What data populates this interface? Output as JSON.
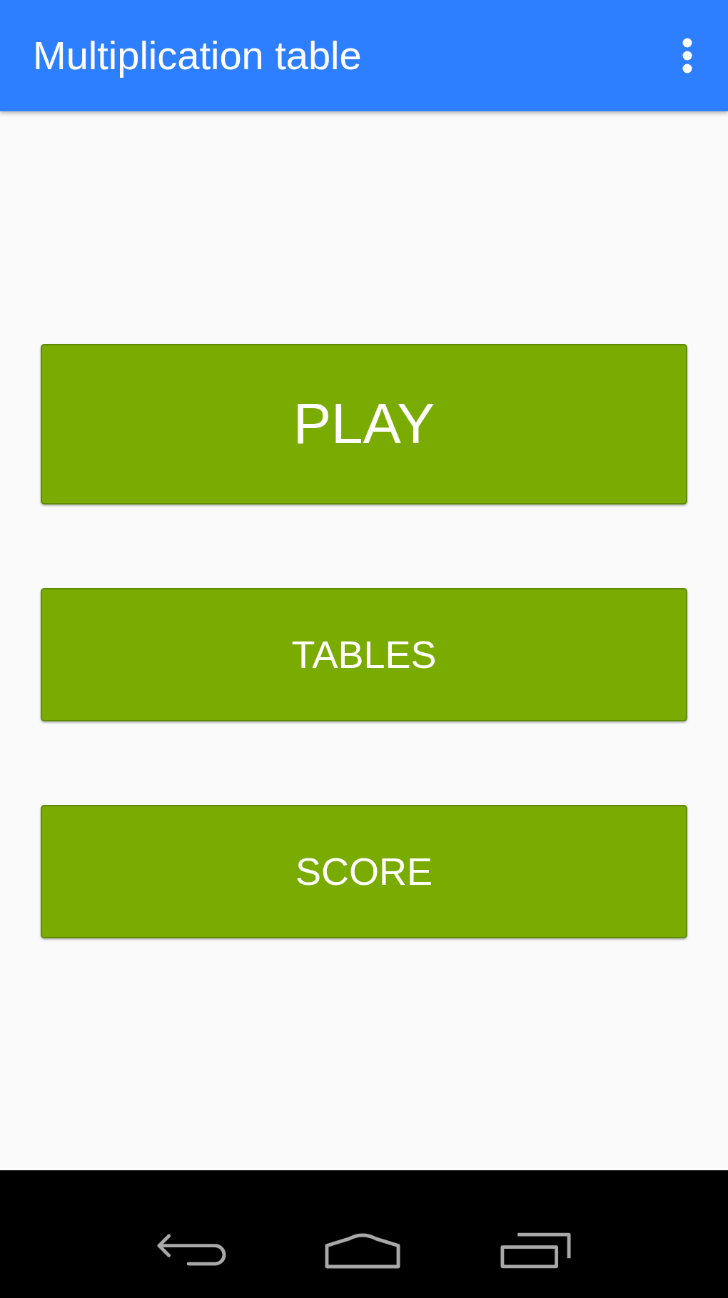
{
  "app_bar": {
    "title": "Multiplication table"
  },
  "buttons": [
    {
      "label": "PLAY",
      "kind": "large"
    },
    {
      "label": "TABLES",
      "kind": "regular"
    },
    {
      "label": "SCORE",
      "kind": "regular"
    }
  ]
}
